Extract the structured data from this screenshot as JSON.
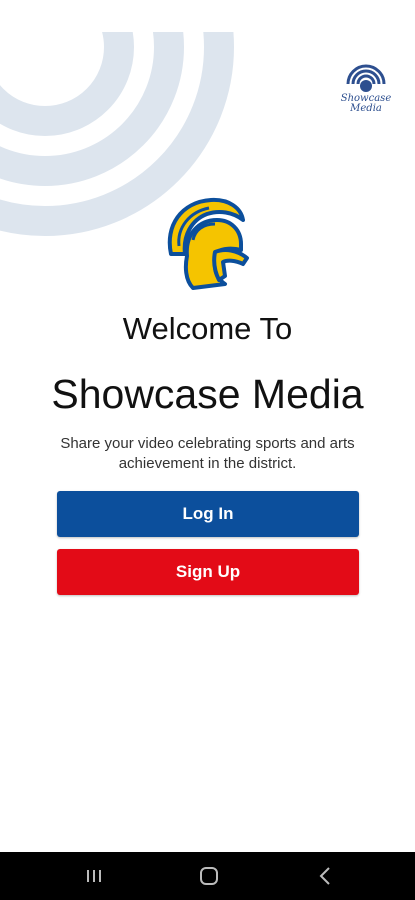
{
  "app": {
    "welcome_text": "Welcome To",
    "title": "Showcase Media",
    "tagline": "Share your video celebrating sports and arts achievement in the district."
  },
  "corner_logo": {
    "line1": "Showcase",
    "line2": "Media"
  },
  "buttons": {
    "login_label": "Log In",
    "signup_label": "Sign Up"
  },
  "colors": {
    "login_button": "#0c4f9c",
    "signup_button": "#e30b17",
    "decor_arcs": "#dde5ee",
    "mascot_gold": "#f5c400",
    "mascot_blue": "#0c4f9c"
  },
  "icons": {
    "mascot": "spartan-helmet-icon",
    "corner_logo": "broadcast-signal-icon",
    "nav_recents": "recent-apps-icon",
    "nav_home": "home-icon",
    "nav_back": "back-icon"
  }
}
